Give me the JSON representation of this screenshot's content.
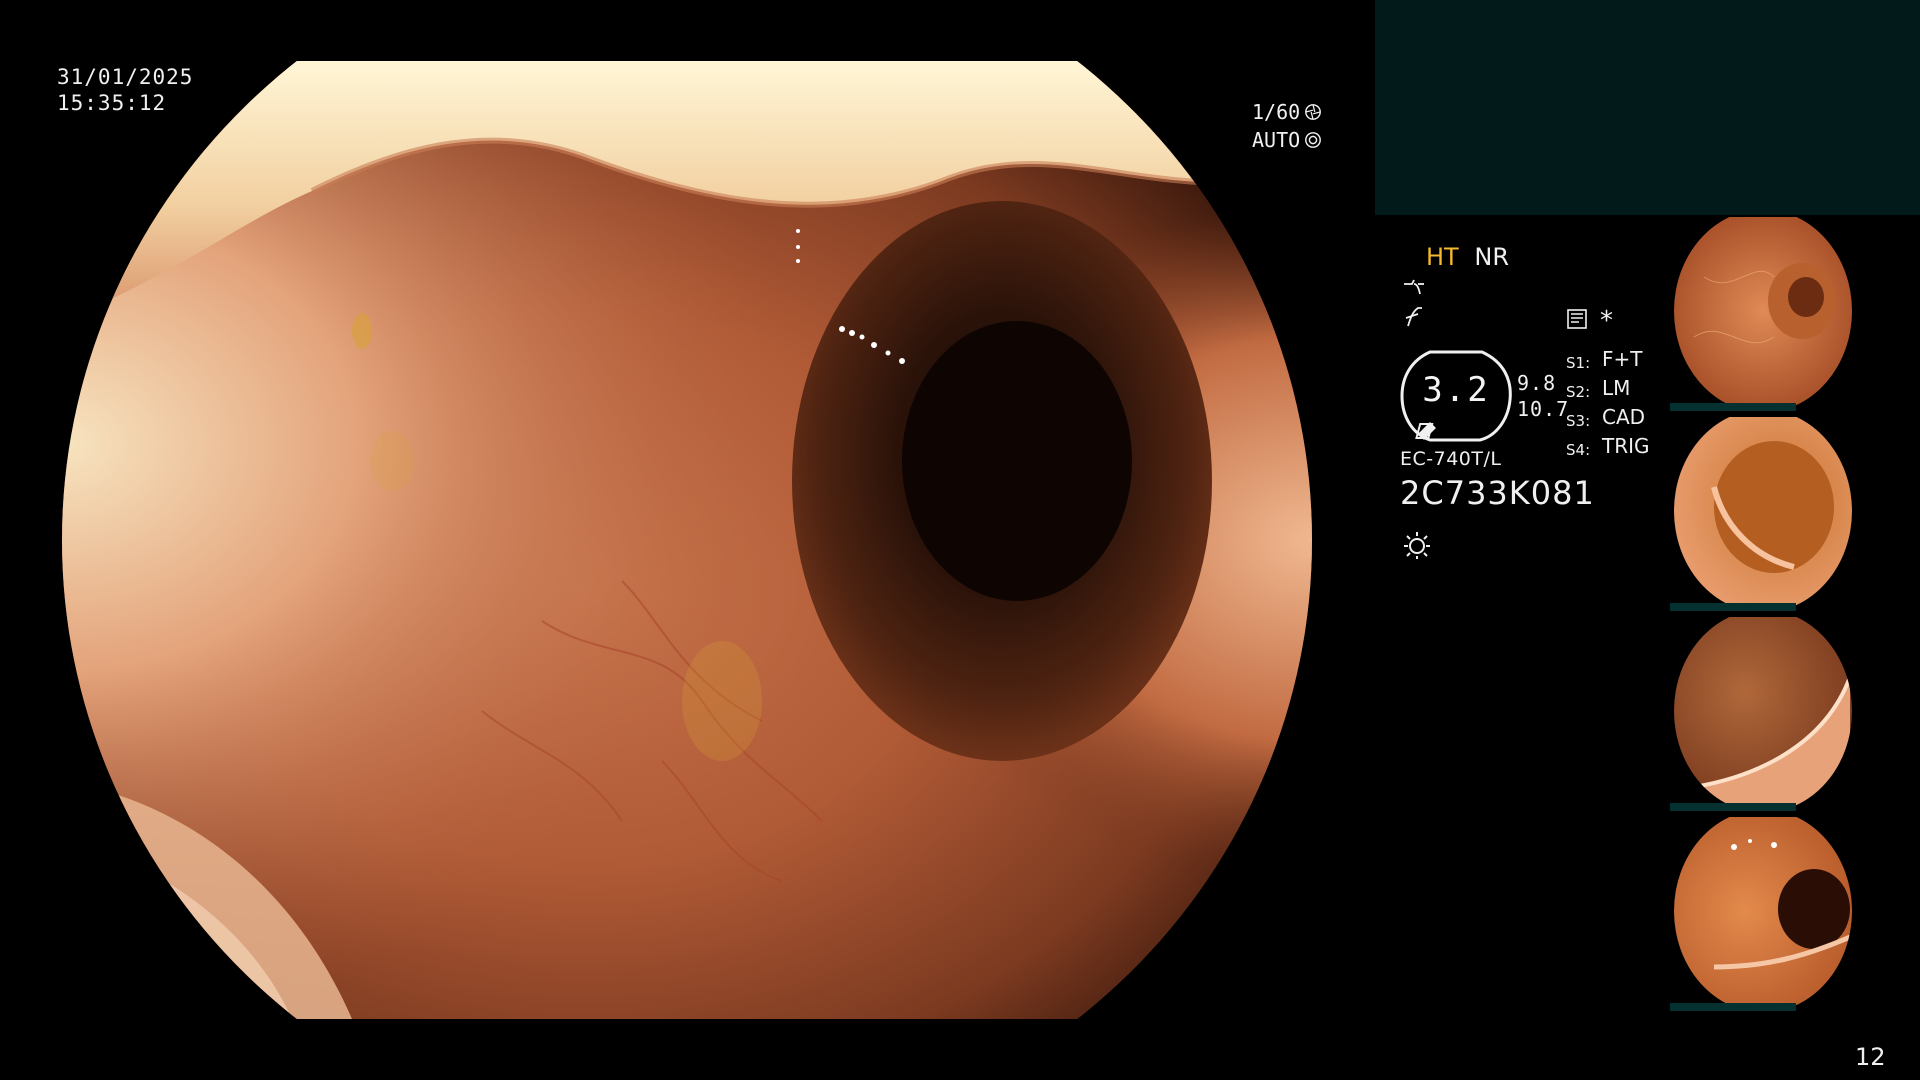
{
  "capture": {
    "date": "31/01/2025",
    "time": "15:35:12"
  },
  "shutter": {
    "speed": "1/60",
    "iris_mode": "AUTO"
  },
  "modes": {
    "ht": "HT",
    "nr": "NR"
  },
  "gauge": {
    "value": "3.2",
    "side_top": "9.8",
    "side_bottom": "10.7"
  },
  "scope": {
    "model": "EC-740T/L",
    "serial": "2C733K081"
  },
  "switches": [
    {
      "key": "S1:",
      "value": "F+T"
    },
    {
      "key": "S2:",
      "value": "LM"
    },
    {
      "key": "S3:",
      "value": "CAD"
    },
    {
      "key": "S4:",
      "value": "TRIG"
    }
  ],
  "asterisk": "*",
  "page_number": "12",
  "colors": {
    "ht_accent": "#f5b82e",
    "panel_teal": "#021a1a",
    "text": "#f0f0f0"
  },
  "icons": [
    "shutter-icon",
    "iris-icon",
    "enhance-curve-icon",
    "freeze-icon",
    "memory-card-icon",
    "light-source-icon"
  ]
}
